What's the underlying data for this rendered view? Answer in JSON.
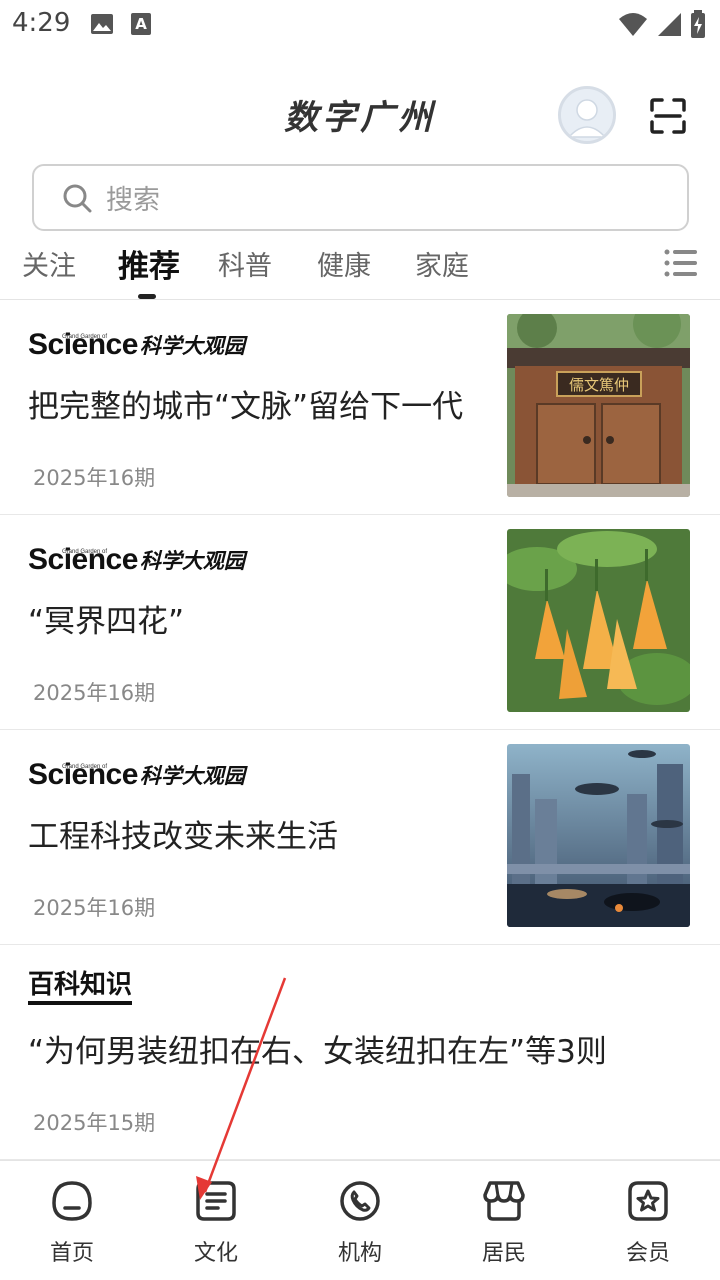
{
  "status_bar": {
    "time": "4:29",
    "icons": [
      "image-icon",
      "text-a-icon",
      "wifi-icon",
      "signal-icon",
      "battery-charging-icon"
    ]
  },
  "header": {
    "title": "数字广州",
    "avatar_icon": "avatar-icon",
    "scan_icon": "scan-icon"
  },
  "search": {
    "placeholder": "搜索",
    "icon": "search-icon"
  },
  "tabs": {
    "items": [
      "关注",
      "推荐",
      "科普",
      "健康",
      "家庭"
    ],
    "active": "推荐",
    "menu_icon": "list-menu-icon"
  },
  "feed": [
    {
      "source_logo": "Science科学大观园",
      "source_logo_main": "Science",
      "source_logo_sub": "Grand Garden of",
      "source_logo_cn": "科学大观园",
      "title": "把完整的城市“文脉”留给下一代",
      "issue": "2025年16期",
      "thumbnail_text": "儒文篤仲"
    },
    {
      "source_logo": "Science科学大观园",
      "source_logo_main": "Science",
      "source_logo_sub": "Grand Garden of",
      "source_logo_cn": "科学大观园",
      "title": "“冥界四花”",
      "issue": "2025年16期",
      "thumbnail_text": ""
    },
    {
      "source_logo": "Science科学大观园",
      "source_logo_main": "Science",
      "source_logo_sub": "Grand Garden of",
      "source_logo_cn": "科学大观园",
      "title": "工程科技改变未来生活",
      "issue": "2025年16期",
      "thumbnail_text": ""
    },
    {
      "source_logo": "百科知识",
      "title": "“为何男装纽扣在右、女装纽扣在左”等3则",
      "issue": "2025年15期"
    }
  ],
  "bottom_nav": [
    {
      "label": "首页",
      "icon": "home-face-icon"
    },
    {
      "label": "文化",
      "icon": "document-icon"
    },
    {
      "label": "机构",
      "icon": "phone-icon"
    },
    {
      "label": "居民",
      "icon": "shop-awning-icon"
    },
    {
      "label": "会员",
      "icon": "star-badge-icon"
    }
  ],
  "colors": {
    "annotation_arrow": "#e53935",
    "text_primary": "#222222",
    "text_secondary": "#888888"
  }
}
